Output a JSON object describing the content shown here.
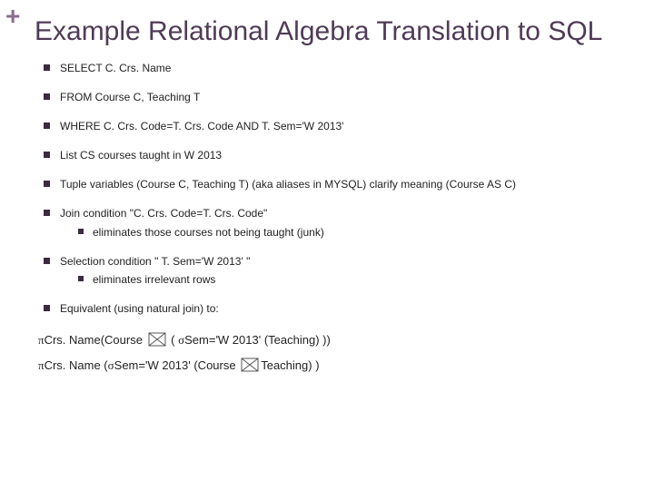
{
  "plus": "+",
  "title": "Example Relational Algebra Translation to SQL",
  "bullets": {
    "b1": "SELECT C. Crs. Name",
    "b2": "FROM Course C, Teaching T",
    "b3": "WHERE C. Crs. Code=T. Crs. Code AND T. Sem='W 2013'",
    "b4": "List CS courses taught in W 2013",
    "b5": "Tuple variables (Course C, Teaching T) (aka aliases in MYSQL) clarify meaning (Course AS C)",
    "b6": "Join condition \"C. Crs. Code=T. Crs. Code\"",
    "b6a": "eliminates those courses not being taught (junk)",
    "b7": "Selection condition \" T. Sem='W 2013' \"",
    "b7a": "eliminates irrelevant rows",
    "b8": "Equivalent (using natural join) to:"
  },
  "formula": {
    "pi": "π",
    "sigma": "σ",
    "f1_pre": "Crs. Name(Course ",
    "f1_mid": " ( ",
    "f1_sig": "Sem='W 2013' (Teaching) ))",
    "f2_pre": "Crs. Name (",
    "f2_sig": "Sem='W 2013' (Course ",
    "f2_post": "Teaching) )"
  }
}
